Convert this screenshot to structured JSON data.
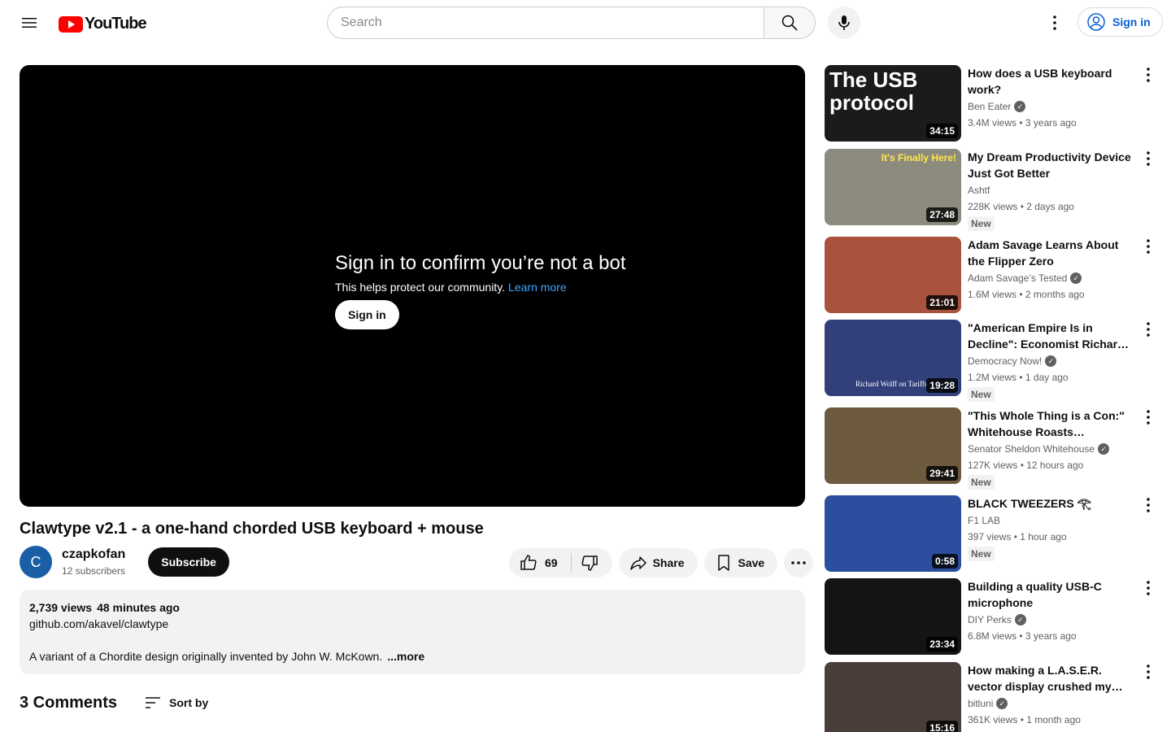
{
  "header": {
    "logo_text": "YouTube",
    "search_placeholder": "Search",
    "signin_label": "Sign in"
  },
  "player": {
    "bot_title": "Sign in to confirm you’re not a bot",
    "bot_subtitle": "This helps protect our community.",
    "learn_more": "Learn more",
    "signin_label": "Sign in"
  },
  "video": {
    "title": "Clawtype v2.1 - a one-hand chorded USB keyboard + mouse",
    "channel_initial": "C",
    "channel_name": "czapkofan",
    "channel_subs": "12 subscribers",
    "subscribe_label": "Subscribe",
    "likes": "69",
    "share_label": "Share",
    "save_label": "Save"
  },
  "description": {
    "views": "2,739 views",
    "age": "48 minutes ago",
    "link": "github.com/akavel/clawtype",
    "text": "A variant of a Chordite design originally invented by John W. McKown.",
    "more_label": "...more"
  },
  "comments": {
    "count_label": "3 Comments",
    "sort_label": "Sort by"
  },
  "recommendations": [
    {
      "title": "How does a USB keyboard work?",
      "channel": "Ben Eater",
      "verified": true,
      "meta": "3.4M views • 3 years ago",
      "duration": "34:15",
      "new": false,
      "thumb_text": "The USB protocol",
      "thumb_bg": "#1b1b1b"
    },
    {
      "title": "My Dream Productivity Device Just Got Better",
      "channel": "Ashtf",
      "verified": false,
      "meta": "228K views • 2 days ago",
      "duration": "27:48",
      "new": true,
      "thumb_text": "It's Finally Here!",
      "thumb_bg": "#8d8a7e"
    },
    {
      "title": "Adam Savage Learns About the Flipper Zero",
      "channel": "Adam Savage’s Tested",
      "verified": true,
      "meta": "1.6M views • 2 months ago",
      "duration": "21:01",
      "new": false,
      "thumb_text": "",
      "thumb_bg": "#a9533e"
    },
    {
      "title": "\"American Empire Is in Decline\": Economist Richard Wolff on …",
      "channel": "Democracy Now!",
      "verified": true,
      "meta": "1.2M views • 1 day ago",
      "duration": "19:28",
      "new": true,
      "thumb_text": "Richard Wolff on Tariffs",
      "thumb_bg": "#31407a"
    },
    {
      "title": "\"This Whole Thing is a Con:\" Whitehouse Roasts Republica…",
      "channel": "Senator Sheldon Whitehouse",
      "verified": true,
      "meta": "127K views • 12 hours ago",
      "duration": "29:41",
      "new": true,
      "thumb_text": "",
      "thumb_bg": "#6e5a3e"
    },
    {
      "title": "BLACK TWEEZERS 𓂀",
      "channel": "F1 LAB",
      "verified": false,
      "meta": "397 views • 1 hour ago",
      "duration": "0:58",
      "new": true,
      "thumb_text": "",
      "thumb_bg": "#2b4f9e"
    },
    {
      "title": "Building a quality USB-C microphone",
      "channel": "DIY Perks",
      "verified": true,
      "meta": "6.8M views • 3 years ago",
      "duration": "23:34",
      "new": false,
      "thumb_text": "",
      "thumb_bg": "#141414"
    },
    {
      "title": "How making a L.A.S.E.R. vector display crushed my soul",
      "channel": "bitluni",
      "verified": true,
      "meta": "361K views • 1 month ago",
      "duration": "15:16",
      "new": false,
      "thumb_text": "",
      "thumb_bg": "#4a3e3a"
    }
  ]
}
